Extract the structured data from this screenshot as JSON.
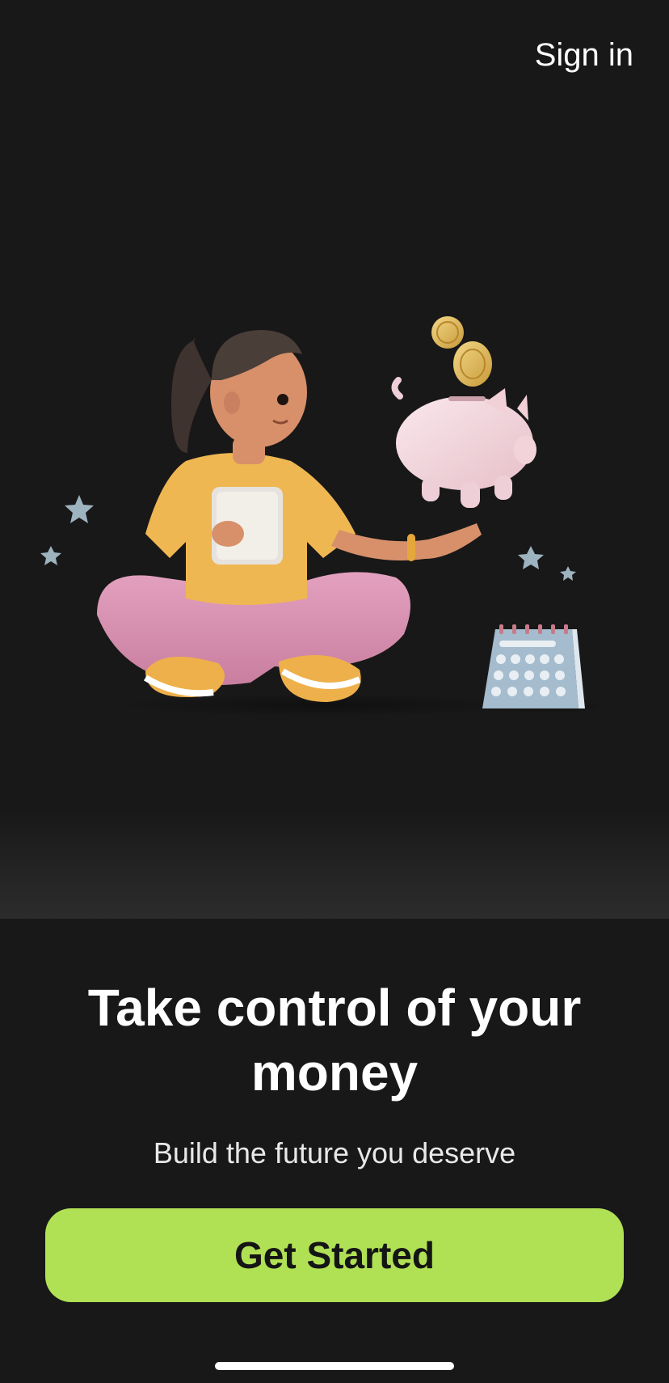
{
  "header": {
    "sign_in_label": "Sign in"
  },
  "hero": {
    "illustration": "person-with-tablet-and-piggy-bank",
    "icons": [
      "piggy-bank-icon",
      "coin-icon",
      "calendar-icon",
      "star-icon"
    ]
  },
  "onboarding": {
    "title": "Take control of your money",
    "subtitle": "Build the future you deserve",
    "cta_label": "Get Started"
  },
  "colors": {
    "background": "#181818",
    "accent": "#b0e155",
    "text": "#ffffff"
  }
}
